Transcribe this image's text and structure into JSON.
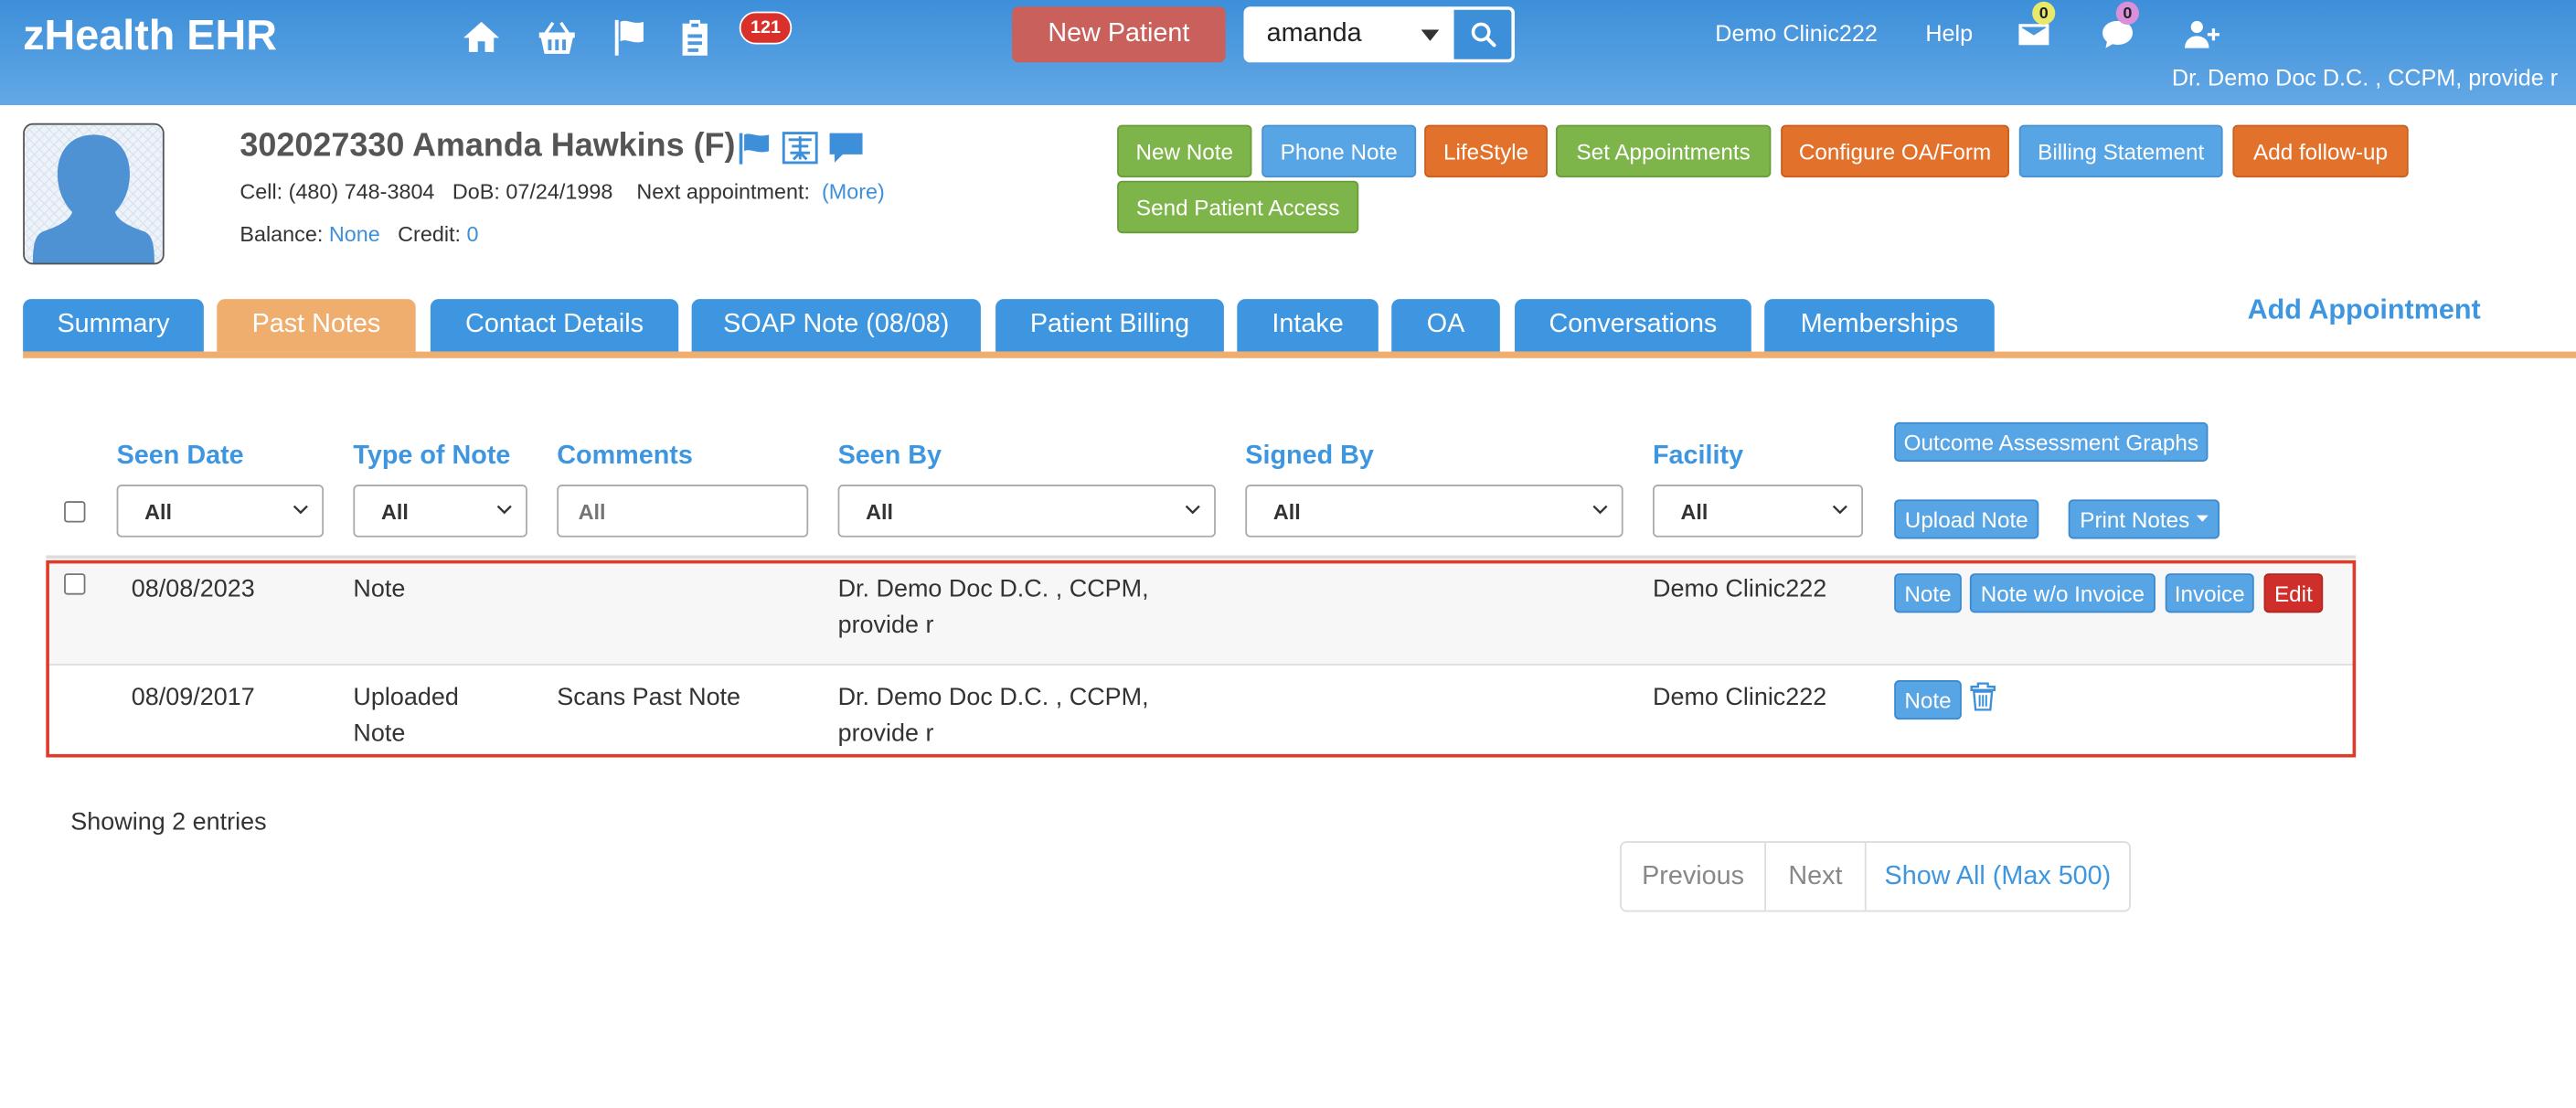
{
  "app": {
    "brand": "zHealth EHR",
    "task_badge_count": "121",
    "new_patient_label": "New Patient",
    "search_value": "amanda",
    "clinic_link": "Demo Clinic222",
    "help_link": "Help",
    "mail_count": "0",
    "chat_count": "0",
    "user_line": "Dr. Demo Doc D.C. , CCPM, provide r",
    "colors": {
      "header": "#3d8fd9",
      "tab": "#3d96df",
      "active_tab": "#f0ae6e",
      "highlight": "#e03a2a"
    }
  },
  "patient": {
    "title": "302027330 Amanda Hawkins (F)",
    "cell_label": "Cell:",
    "cell": "(480) 748-3804",
    "dob_label": "DoB:",
    "dob": "07/24/1998",
    "next_appt_label": "Next appointment:",
    "more_link": "(More)",
    "balance_label": "Balance:",
    "balance": "None",
    "credit_label": "Credit:",
    "credit": "0"
  },
  "actions": {
    "new_note": "New Note",
    "phone_note": "Phone Note",
    "lifestyle": "LifeStyle",
    "set_appointments": "Set Appointments",
    "configure_oa": "Configure OA/Form",
    "billing_statement": "Billing Statement",
    "add_followup": "Add follow-up",
    "send_patient_access": "Send Patient Access"
  },
  "tabs": [
    {
      "label": "Summary"
    },
    {
      "label": "Past Notes",
      "active": true
    },
    {
      "label": "Contact Details"
    },
    {
      "label": "SOAP Note (08/08)"
    },
    {
      "label": "Patient Billing"
    },
    {
      "label": "Intake"
    },
    {
      "label": "OA"
    },
    {
      "label": "Conversations"
    },
    {
      "label": "Memberships"
    }
  ],
  "add_appointment": "Add Appointment",
  "table": {
    "columns": [
      "Seen Date",
      "Type of Note",
      "Comments",
      "Seen By",
      "Signed By",
      "Facility"
    ],
    "filters": {
      "seen_date": "All",
      "type_of_note": "All",
      "comments_placeholder": "All",
      "seen_by": "All",
      "signed_by": "All",
      "facility": "All"
    },
    "outcome_graphs": "Outcome Assessment Graphs",
    "upload_note": "Upload Note",
    "print_notes": "Print Notes",
    "rows": [
      {
        "seen_date": "08/08/2023",
        "type": "Note",
        "comments": "",
        "seen_by_1": "Dr. Demo Doc D.C. , CCPM,",
        "seen_by_2": "provide r",
        "signed_by": "",
        "facility": "Demo Clinic222",
        "actions": [
          "Note",
          "Note w/o Invoice",
          "Invoice",
          "Edit"
        ]
      },
      {
        "seen_date": "08/09/2017",
        "type_1": "Uploaded",
        "type_2": "Note",
        "comments": "Scans Past Note",
        "seen_by_1": "Dr. Demo Doc D.C. , CCPM,",
        "seen_by_2": "provide r",
        "signed_by": "",
        "facility": "Demo Clinic222",
        "actions": [
          "Note"
        ]
      }
    ]
  },
  "footer": {
    "showing": "Showing 2 entries",
    "previous": "Previous",
    "next": "Next",
    "show_all": "Show All (Max 500)"
  }
}
